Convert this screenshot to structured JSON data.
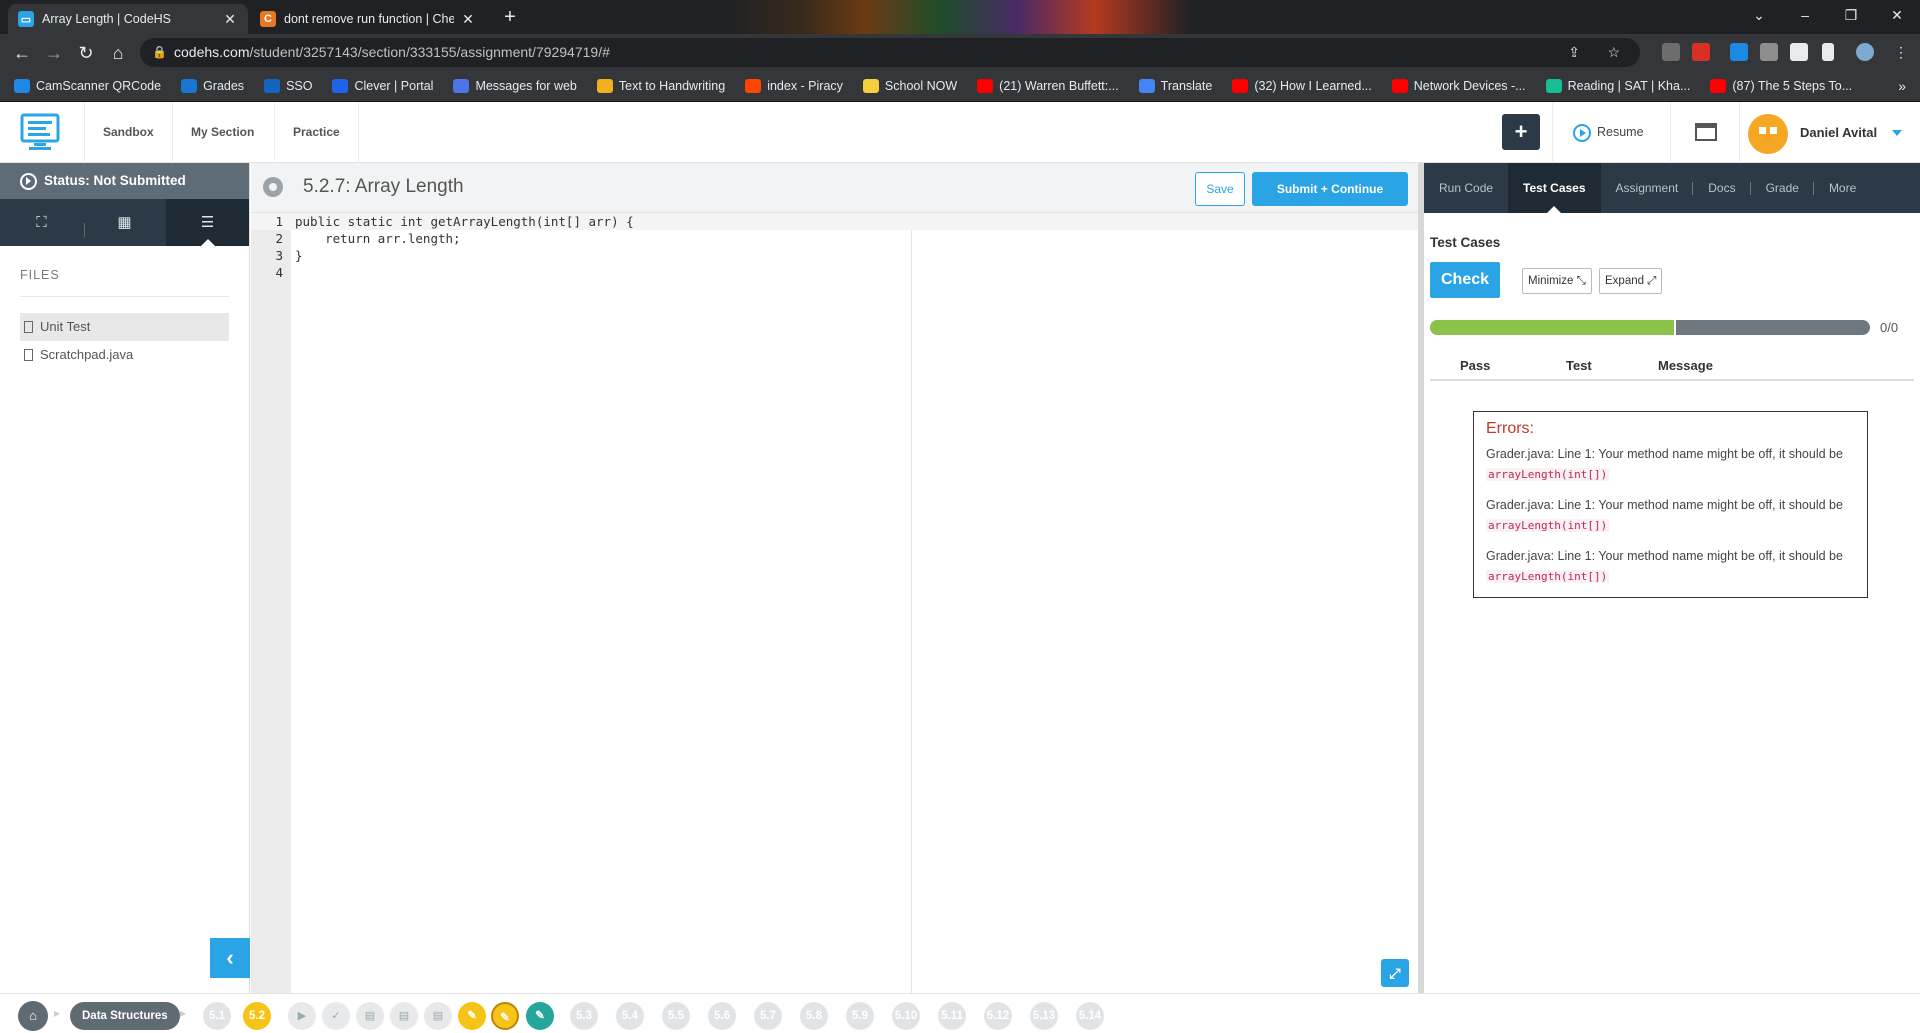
{
  "browser": {
    "tabs": [
      {
        "title": "Array Length | CodeHS",
        "active": true
      },
      {
        "title": "dont remove run function | Cheg",
        "active": false
      }
    ],
    "url_host": "codehs.com",
    "url_path": "/student/3257143/section/333155/assignment/79294719/#",
    "bookmarks": [
      {
        "label": "CamScanner QRCode",
        "icon": "cs-icon",
        "color": "#1e88e5"
      },
      {
        "label": "Grades",
        "icon": "w-icon",
        "color": "#1976d2"
      },
      {
        "label": "SSO",
        "icon": "sso-icon",
        "color": "#1565c0"
      },
      {
        "label": "Clever | Portal",
        "icon": "clever-icon",
        "color": "#1e63e9"
      },
      {
        "label": "Messages for web",
        "icon": "messages-icon",
        "color": "#4f74e8"
      },
      {
        "label": "Text to Handwriting",
        "icon": "pen-icon",
        "color": "#f2b01e"
      },
      {
        "label": "index - Piracy",
        "icon": "reddit-icon",
        "color": "#ff4500"
      },
      {
        "label": "School NOW",
        "icon": "note-icon",
        "color": "#f4d03f"
      },
      {
        "label": "(21) Warren Buffett:...",
        "icon": "youtube-icon",
        "color": "#ff0000"
      },
      {
        "label": "Translate",
        "icon": "translate-icon",
        "color": "#4285f4"
      },
      {
        "label": "(32) How I Learned...",
        "icon": "youtube-icon",
        "color": "#ff0000"
      },
      {
        "label": "Network Devices -...",
        "icon": "youtube-icon",
        "color": "#ff0000"
      },
      {
        "label": "Reading | SAT | Kha...",
        "icon": "khan-icon",
        "color": "#14bf96"
      },
      {
        "label": "(87) The 5 Steps To...",
        "icon": "youtube-icon",
        "color": "#ff0000"
      }
    ]
  },
  "header": {
    "nav": [
      "Sandbox",
      "My Section",
      "Practice"
    ],
    "resume_label": "Resume",
    "user_name": "Daniel Avital",
    "plus_label": "+"
  },
  "sidebar": {
    "status": "Status: Not Submitted",
    "files_heading": "FILES",
    "files": [
      {
        "name": "Unit Test",
        "active": true
      },
      {
        "name": "Scratchpad.java",
        "active": false
      }
    ]
  },
  "editor": {
    "title": "5.2.7: Array Length",
    "save_label": "Save",
    "submit_label": "Submit + Continue",
    "lines": [
      "public static int getArrayLength(int[] arr) {",
      "    return arr.length;",
      "}",
      ""
    ],
    "line_numbers": [
      "1",
      "2",
      "3",
      "4"
    ]
  },
  "right_panel": {
    "tabs": [
      "Run Code",
      "Test Cases",
      "Assignment",
      "Docs",
      "Grade",
      "More"
    ],
    "active_tab": "Test Cases",
    "heading": "Test Cases",
    "check_label": "Check",
    "minimize_label": "Minimize",
    "expand_label": "Expand",
    "progress_fraction": 0.56,
    "progress_text": "0/0",
    "columns": [
      "Pass",
      "Test",
      "Message"
    ],
    "errors_title": "Errors:",
    "errors": [
      {
        "text": "Grader.java: Line 1: Your method name might be off, it should be",
        "code": "arrayLength(int[])"
      },
      {
        "text": "Grader.java: Line 1: Your method name might be off, it should be",
        "code": "arrayLength(int[])"
      },
      {
        "text": "Grader.java: Line 1: Your method name might be off, it should be",
        "code": "arrayLength(int[])"
      }
    ]
  },
  "bottom_nav": {
    "unit": "Data Structures",
    "lessons_before": [
      "5.1",
      "5.2"
    ],
    "lessons_after": [
      "5.3",
      "5.4",
      "5.5",
      "5.6",
      "5.7",
      "5.8",
      "5.9",
      "5.10",
      "5.11",
      "5.12",
      "5.13",
      "5.14"
    ]
  },
  "colors": {
    "accent": "#2aa4e4",
    "dark_nav": "#2b3a46",
    "progress_green": "#8bc34a",
    "error_red": "#c0392b",
    "current_lesson": "#f6c417"
  }
}
